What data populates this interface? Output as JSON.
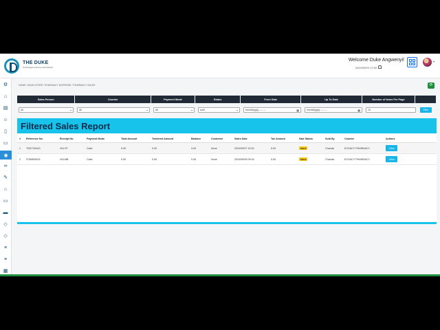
{
  "header": {
    "brand_name": "THE DUKE",
    "brand_sub": "Technologies & Services Hub Network",
    "welcome": "Welcome Duke Angwenyi!",
    "datetime": "2024/09/09 17:50"
  },
  "breadcrumb": "HOME  /  MAIN STORE  /  PHARMACY DISPENSE  /  PHARMACY SALES",
  "filters": {
    "headers": [
      "Sales Person",
      "Counter",
      "Payment Mode",
      "Status",
      "From Date",
      "Up To Date",
      "Number of Items Per Page",
      ""
    ],
    "sales_person": "All",
    "counter": "All",
    "payment_mode": "All",
    "status": "sold",
    "from_date_placeholder": "mm/dd/yyyy --:-- --",
    "up_to_date_placeholder": "mm/dd/yyyy --:-- --",
    "items_per_page": "10",
    "filter_label": "Filter"
  },
  "report": {
    "title": "Filtered Sales Report",
    "columns": [
      "#",
      "Reference No.",
      "Receipt No.",
      "Payment Mode",
      "Total Amount",
      "Tendered Amount",
      "Balance",
      "Customer",
      "Sales Date",
      "Tax Amount",
      "Sale Status",
      "Sold By",
      "Counter",
      "Actions"
    ],
    "rows": [
      {
        "num": "1",
        "ref": "7002716343",
        "receipt": "XKLYP",
        "mode": "Cash",
        "total": "0.00",
        "tendered": "0.00",
        "balance": "0.00",
        "customer": "None",
        "date": "2024/09/07 15:22",
        "tax": "0.00",
        "status": "SOLD",
        "sold_by": "Chanda",
        "counter": "ECSACY PHARMACY",
        "action": "View"
      },
      {
        "num": "2",
        "ref": "0750809024",
        "receipt": "XKLMB",
        "mode": "Cash",
        "total": "0.00",
        "tendered": "0.00",
        "balance": "0.00",
        "customer": "None",
        "date": "2024/09/09 09:34",
        "tax": "0.00",
        "status": "SOLD",
        "sold_by": "Chanda",
        "counter": "ECSACY PHARMACY",
        "action": "View"
      }
    ]
  },
  "colors": {
    "accent": "#17c3ea",
    "header_dark": "#1f2a36",
    "sidebar_active": "#2a8fd6",
    "badge": "#f7c518"
  },
  "sidebar_icons": [
    "settings-icon",
    "home-icon",
    "store-icon",
    "users-icon",
    "document-icon",
    "clipboard-icon",
    "pill-icon",
    "link-icon",
    "pen-icon",
    "bank-icon",
    "monitor-icon",
    "truck-icon",
    "tag-icon",
    "tag-icon",
    "list-icon",
    "list-icon",
    "chart-icon",
    "chart-icon",
    "list-icon"
  ]
}
